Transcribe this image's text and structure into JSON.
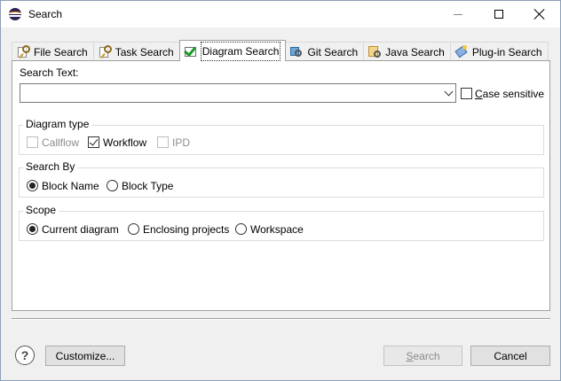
{
  "window": {
    "title": "Search"
  },
  "tabs": [
    {
      "label": "File Search",
      "icon": "file-search-icon",
      "active": false
    },
    {
      "label": "Task Search",
      "icon": "task-search-icon",
      "active": false
    },
    {
      "label": "Diagram Search",
      "icon": "diagram-search-icon",
      "active": true
    },
    {
      "label": "Git Search",
      "icon": "git-search-icon",
      "active": false
    },
    {
      "label": "Java Search",
      "icon": "java-search-icon",
      "active": false
    },
    {
      "label": "Plug-in Search",
      "icon": "plugin-search-icon",
      "active": false
    }
  ],
  "search_text": {
    "label": "Search Text:",
    "value": "",
    "case_sensitive_label": "Case sensitive",
    "case_sensitive_mnemonic": "C",
    "case_sensitive_rest": "ase sensitive",
    "case_sensitive_checked": false
  },
  "diagram_type": {
    "title": "Diagram type",
    "options": [
      {
        "label": "Callflow",
        "checked": false,
        "enabled": false
      },
      {
        "label": "Workflow",
        "checked": true,
        "enabled": true
      },
      {
        "label": "IPD",
        "checked": false,
        "enabled": false
      }
    ]
  },
  "search_by": {
    "title": "Search By",
    "options": [
      {
        "label": "Block Name",
        "selected": true
      },
      {
        "label": "Block Type",
        "selected": false
      }
    ]
  },
  "scope": {
    "title": "Scope",
    "options": [
      {
        "label": "Current diagram",
        "selected": true
      },
      {
        "label": "Enclosing projects",
        "selected": false
      },
      {
        "label": "Workspace",
        "selected": false
      }
    ]
  },
  "footer": {
    "help_glyph": "?",
    "customize_label": "Customize...",
    "search_label": "Search",
    "search_mnemonic": "S",
    "search_rest": "earch",
    "search_enabled": false,
    "cancel_label": "Cancel"
  },
  "colors": {
    "window_bg": "#f0f0f0",
    "panel_bg": "#ffffff",
    "disabled_text": "#8d8d8d",
    "check_green": "#1a9a2a"
  }
}
